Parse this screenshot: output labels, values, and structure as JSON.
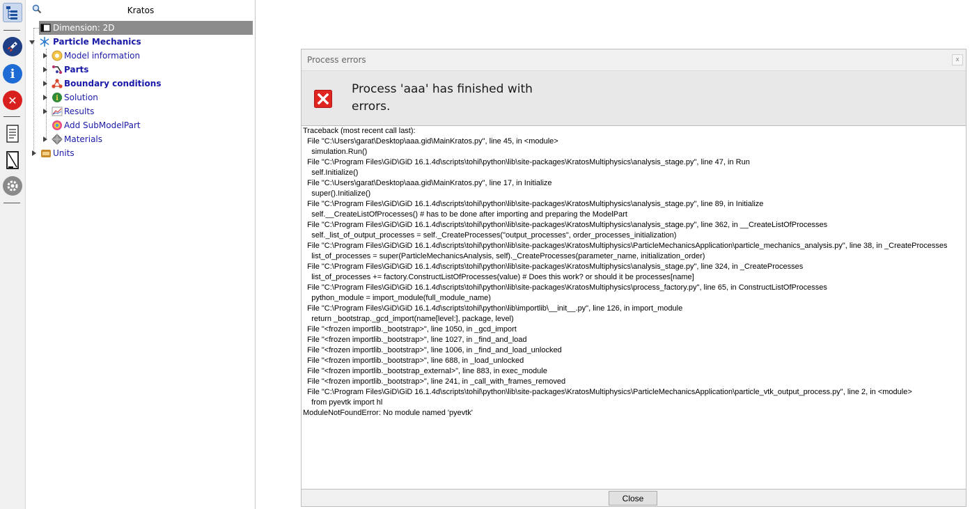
{
  "tree": {
    "title": "Kratos",
    "items": [
      {
        "label": "Dimension: 2D"
      },
      {
        "label": "Particle Mechanics"
      },
      {
        "label": "Model information"
      },
      {
        "label": "Parts"
      },
      {
        "label": "Boundary conditions"
      },
      {
        "label": "Solution"
      },
      {
        "label": "Results"
      },
      {
        "label": "Add SubModelPart"
      },
      {
        "label": "Materials"
      },
      {
        "label": "Units"
      }
    ]
  },
  "dialog": {
    "title": "Process errors",
    "close_glyph": "x",
    "message": "Process 'aaa' has finished with errors.",
    "close_button": "Close",
    "traceback": [
      "Traceback (most recent call last):",
      "  File \"C:\\Users\\garat\\Desktop\\aaa.gid\\MainKratos.py\", line 45, in <module>",
      "    simulation.Run()",
      "  File \"C:\\Program Files\\GiD\\GiD 16.1.4d\\scripts\\tohil\\python\\lib\\site-packages\\KratosMultiphysics\\analysis_stage.py\", line 47, in Run",
      "    self.Initialize()",
      "  File \"C:\\Users\\garat\\Desktop\\aaa.gid\\MainKratos.py\", line 17, in Initialize",
      "    super().Initialize()",
      "  File \"C:\\Program Files\\GiD\\GiD 16.1.4d\\scripts\\tohil\\python\\lib\\site-packages\\KratosMultiphysics\\analysis_stage.py\", line 89, in Initialize",
      "    self.__CreateListOfProcesses() # has to be done after importing and preparing the ModelPart",
      "  File \"C:\\Program Files\\GiD\\GiD 16.1.4d\\scripts\\tohil\\python\\lib\\site-packages\\KratosMultiphysics\\analysis_stage.py\", line 362, in __CreateListOfProcesses",
      "    self._list_of_output_processes = self._CreateProcesses(\"output_processes\", order_processes_initialization)",
      "  File \"C:\\Program Files\\GiD\\GiD 16.1.4d\\scripts\\tohil\\python\\lib\\site-packages\\KratosMultiphysics\\ParticleMechanicsApplication\\particle_mechanics_analysis.py\", line 38, in _CreateProcesses",
      "    list_of_processes = super(ParticleMechanicsAnalysis, self)._CreateProcesses(parameter_name, initialization_order)",
      "  File \"C:\\Program Files\\GiD\\GiD 16.1.4d\\scripts\\tohil\\python\\lib\\site-packages\\KratosMultiphysics\\analysis_stage.py\", line 324, in _CreateProcesses",
      "    list_of_processes += factory.ConstructListOfProcesses(value) # Does this work? or should it be processes[name]",
      "  File \"C:\\Program Files\\GiD\\GiD 16.1.4d\\scripts\\tohil\\python\\lib\\site-packages\\KratosMultiphysics\\process_factory.py\", line 65, in ConstructListOfProcesses",
      "    python_module = import_module(full_module_name)",
      "  File \"C:\\Program Files\\GiD\\GiD 16.1.4d\\scripts\\tohil\\python\\lib\\importlib\\__init__.py\", line 126, in import_module",
      "    return _bootstrap._gcd_import(name[level:], package, level)",
      "  File \"<frozen importlib._bootstrap>\", line 1050, in _gcd_import",
      "  File \"<frozen importlib._bootstrap>\", line 1027, in _find_and_load",
      "  File \"<frozen importlib._bootstrap>\", line 1006, in _find_and_load_unlocked",
      "  File \"<frozen importlib._bootstrap>\", line 688, in _load_unlocked",
      "  File \"<frozen importlib._bootstrap_external>\", line 883, in exec_module",
      "  File \"<frozen importlib._bootstrap>\", line 241, in _call_with_frames_removed",
      "  File \"C:\\Program Files\\GiD\\GiD 16.1.4d\\scripts\\tohil\\python\\lib\\site-packages\\KratosMultiphysics\\ParticleMechanicsApplication\\particle_vtk_output_process.py\", line 2, in <module>",
      "    from pyevtk import hl",
      "ModuleNotFoundError: No module named 'pyevtk'"
    ]
  }
}
